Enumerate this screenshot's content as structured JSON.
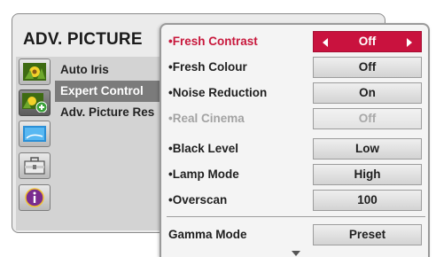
{
  "back_menu": {
    "title": "ADV. PICTURE",
    "items": [
      {
        "label": "Auto Iris"
      },
      {
        "label": "Expert Control"
      },
      {
        "label": "Adv. Picture Res"
      }
    ],
    "icons": [
      "picture-icon",
      "picture-plus-icon",
      "screen-icon",
      "briefcase-icon",
      "info-icon"
    ]
  },
  "expert_menu": {
    "rows": [
      {
        "label": "•Fresh Contrast",
        "value": "Off"
      },
      {
        "label": "•Fresh Colour",
        "value": "Off"
      },
      {
        "label": "•Noise Reduction",
        "value": "On"
      },
      {
        "label": "•Real Cinema",
        "value": "Off"
      },
      {
        "label": "•Black Level",
        "value": "Low"
      },
      {
        "label": "•Lamp Mode",
        "value": "High"
      },
      {
        "label": "•Overscan",
        "value": "100"
      }
    ],
    "gamma": {
      "label": "Gamma Mode",
      "value": "Preset"
    }
  },
  "colors": {
    "highlight_red": "#c9123e",
    "selected_gray": "#7b7b7b"
  }
}
